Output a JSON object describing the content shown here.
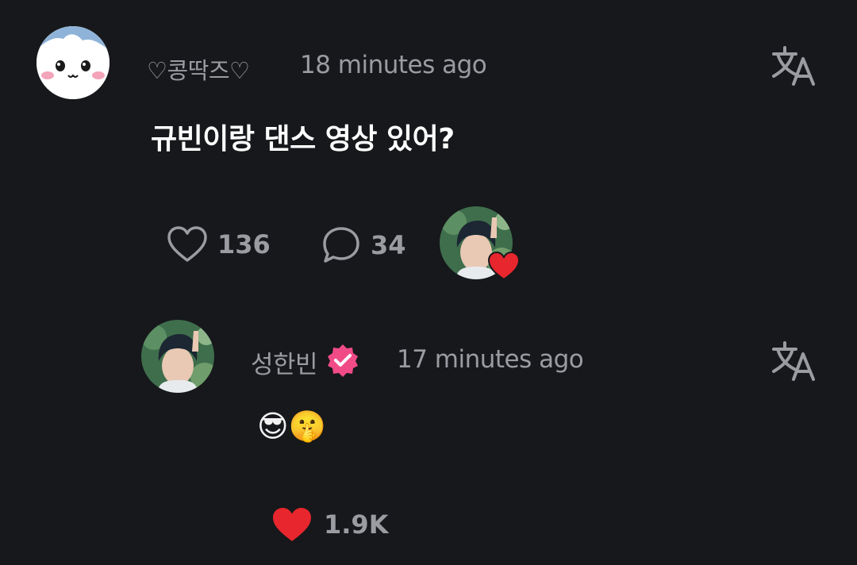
{
  "comment": {
    "author": "♡콩딱즈♡",
    "time": "18 minutes ago",
    "text": "규빈이랑 댄스 영상 있어?",
    "likes": "136",
    "replies": "34",
    "liked_by_artist": true,
    "translate_icon": "translate-icon"
  },
  "reply": {
    "author": "성한빈",
    "verified": true,
    "time": "17 minutes ago",
    "text": "😎🤫",
    "likes": "1.9K",
    "liked": true,
    "translate_icon": "translate-icon"
  },
  "colors": {
    "background": "#16181b",
    "muted_text": "#9a9ca2",
    "heart_red": "#e8262d",
    "verified_pink": "#f14b86"
  }
}
